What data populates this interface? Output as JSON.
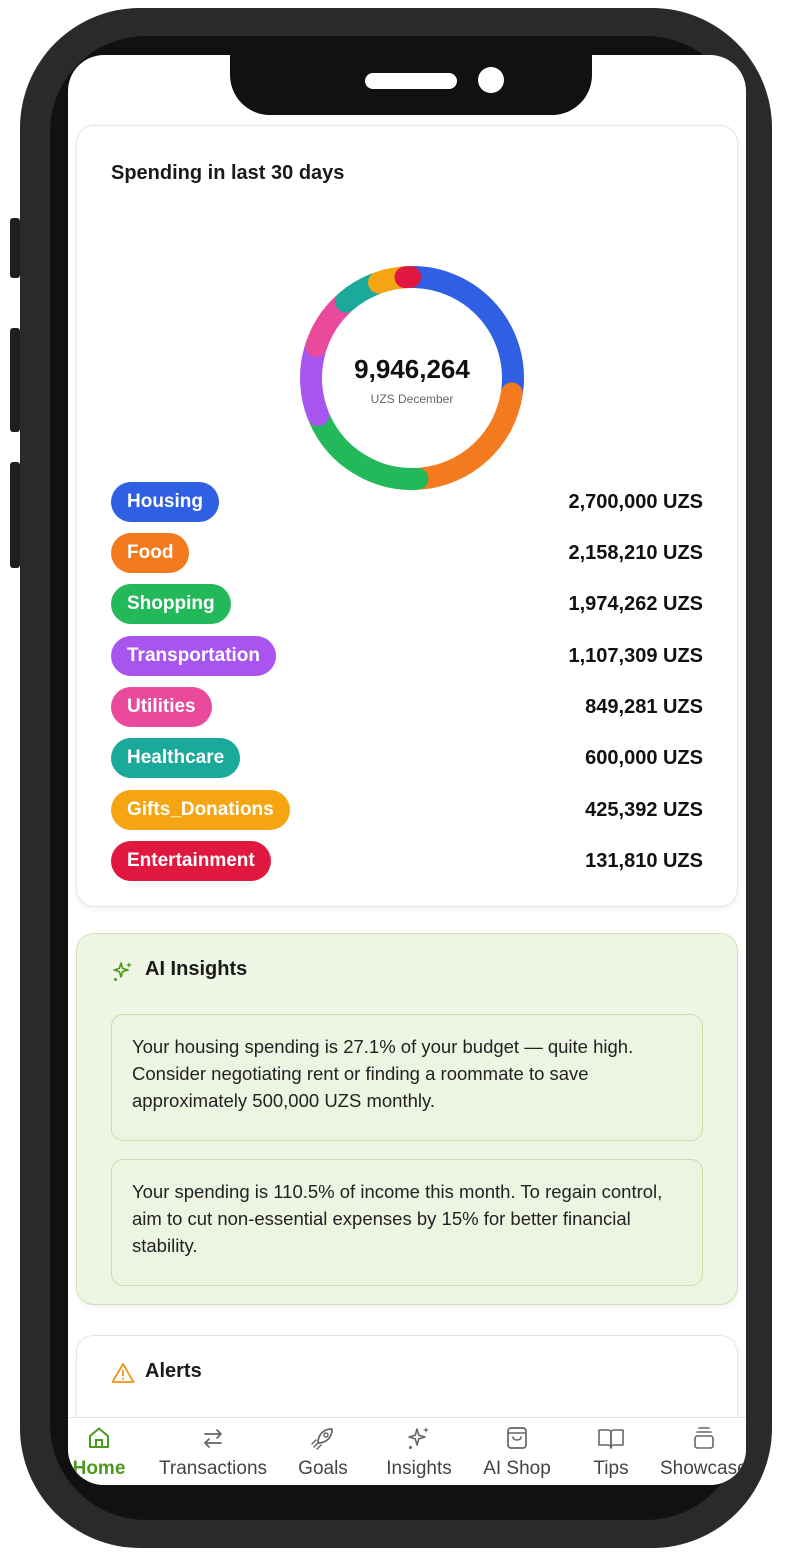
{
  "spending": {
    "title": "Spending in last 30 days",
    "total": "9,946,264",
    "total_caption": "UZS December",
    "categories": [
      {
        "label": "Housing",
        "amount": "2,700,000 UZS",
        "value": 2700000,
        "color": "#2f5fe3"
      },
      {
        "label": "Food",
        "amount": "2,158,210 UZS",
        "value": 2158210,
        "color": "#f47a1f"
      },
      {
        "label": "Shopping",
        "amount": "1,974,262 UZS",
        "value": 1974262,
        "color": "#23b85a"
      },
      {
        "label": "Transportation",
        "amount": "1,107,309 UZS",
        "value": 1107309,
        "color": "#a855f0"
      },
      {
        "label": "Utilities",
        "amount": "849,281 UZS",
        "value": 849281,
        "color": "#e94a9c"
      },
      {
        "label": "Healthcare",
        "amount": "600,000 UZS",
        "value": 600000,
        "color": "#1aa99a"
      },
      {
        "label": "Gifts_Donations",
        "amount": "425,392 UZS",
        "value": 425392,
        "color": "#f5a512"
      },
      {
        "label": "Entertainment",
        "amount": "131,810 UZS",
        "value": 131810,
        "color": "#e0183f"
      }
    ]
  },
  "ai_insights": {
    "title": "AI Insights",
    "items": [
      "Your housing spending is 27.1% of your budget — quite high. Consider negotiating rent or finding a roommate to save approximately 500,000 UZS monthly.",
      "Your spending is 110.5% of income this month. To regain control, aim to cut non-essential expenses by 15% for better financial stability."
    ]
  },
  "alerts": {
    "title": "Alerts"
  },
  "nav": {
    "items": [
      {
        "label": "Home",
        "icon": "home-icon",
        "active": true
      },
      {
        "label": "Transactions",
        "icon": "arrows-icon",
        "active": false
      },
      {
        "label": "Goals",
        "icon": "rocket-icon",
        "active": false
      },
      {
        "label": "Insights",
        "icon": "sparkles-icon",
        "active": false
      },
      {
        "label": "AI Shop",
        "icon": "bag-icon",
        "active": false
      },
      {
        "label": "Tips",
        "icon": "book-icon",
        "active": false
      },
      {
        "label": "Showcase",
        "icon": "stack-icon",
        "active": false
      }
    ]
  }
}
